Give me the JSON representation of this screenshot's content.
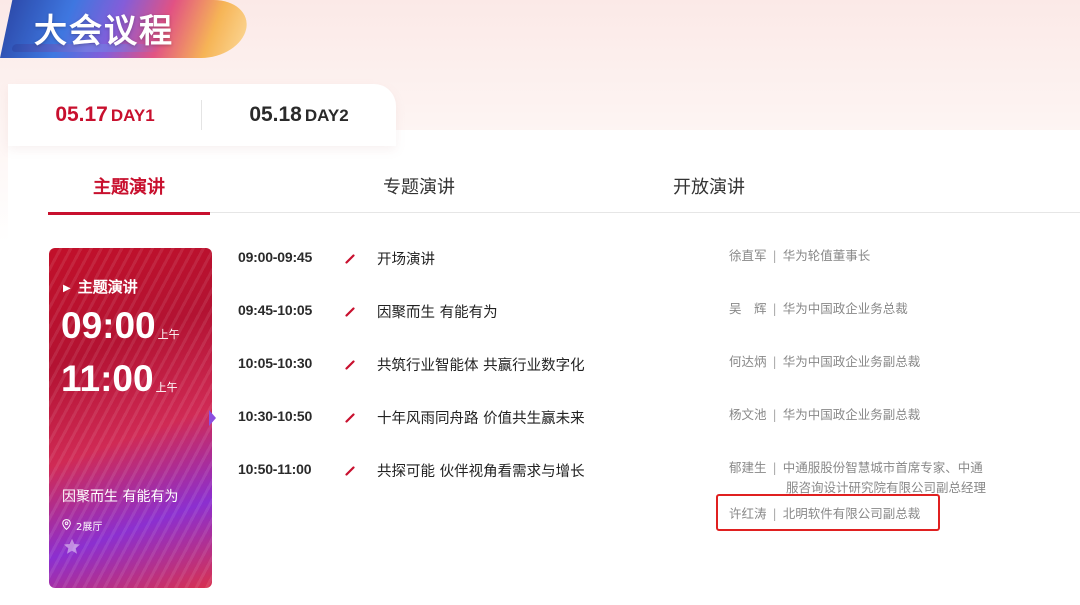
{
  "page_title": "大会议程",
  "days": [
    {
      "date": "05.17",
      "day": "DAY1",
      "active": true
    },
    {
      "date": "05.18",
      "day": "DAY2",
      "active": false
    }
  ],
  "session_tabs": [
    {
      "label": "主题演讲",
      "active": true
    },
    {
      "label": "专题演讲",
      "active": false
    },
    {
      "label": "开放演讲",
      "active": false
    }
  ],
  "session_card": {
    "label": "主题演讲",
    "start_time": "09:00",
    "start_ampm": "上午",
    "end_time": "11:00",
    "end_ampm": "上午",
    "topic": "因聚而生 有能有为",
    "location": "2展厅"
  },
  "agenda": [
    {
      "time": "09:00-09:45",
      "topic": "开场演讲",
      "speakers": [
        {
          "name": "徐直军",
          "org": "华为轮值董事长"
        }
      ]
    },
    {
      "time": "09:45-10:05",
      "topic": "因聚而生 有能有为",
      "speakers": [
        {
          "name": "吴　辉",
          "org": "华为中国政企业务总裁"
        }
      ]
    },
    {
      "time": "10:05-10:30",
      "topic": "共筑行业智能体 共赢行业数字化",
      "speakers": [
        {
          "name": "何达炳",
          "org": "华为中国政企业务副总裁"
        }
      ]
    },
    {
      "time": "10:30-10:50",
      "topic": "十年风雨同舟路 价值共生赢未来",
      "speakers": [
        {
          "name": "杨文池",
          "org": "华为中国政企业务副总裁"
        }
      ]
    },
    {
      "time": "10:50-11:00",
      "topic": "共探可能 伙伴视角看需求与增长",
      "speakers": [
        {
          "name": "郁建生",
          "org_line1": "中通服股份智慧城市首席专家、中通",
          "org_line2": "服咨询设计研究院有限公司副总经理"
        },
        {
          "name": "许红涛",
          "org": "北明软件有限公司副总裁"
        }
      ]
    }
  ],
  "separator": "|",
  "colors": {
    "accent": "#c8102e",
    "highlight_box": "#e02020"
  }
}
